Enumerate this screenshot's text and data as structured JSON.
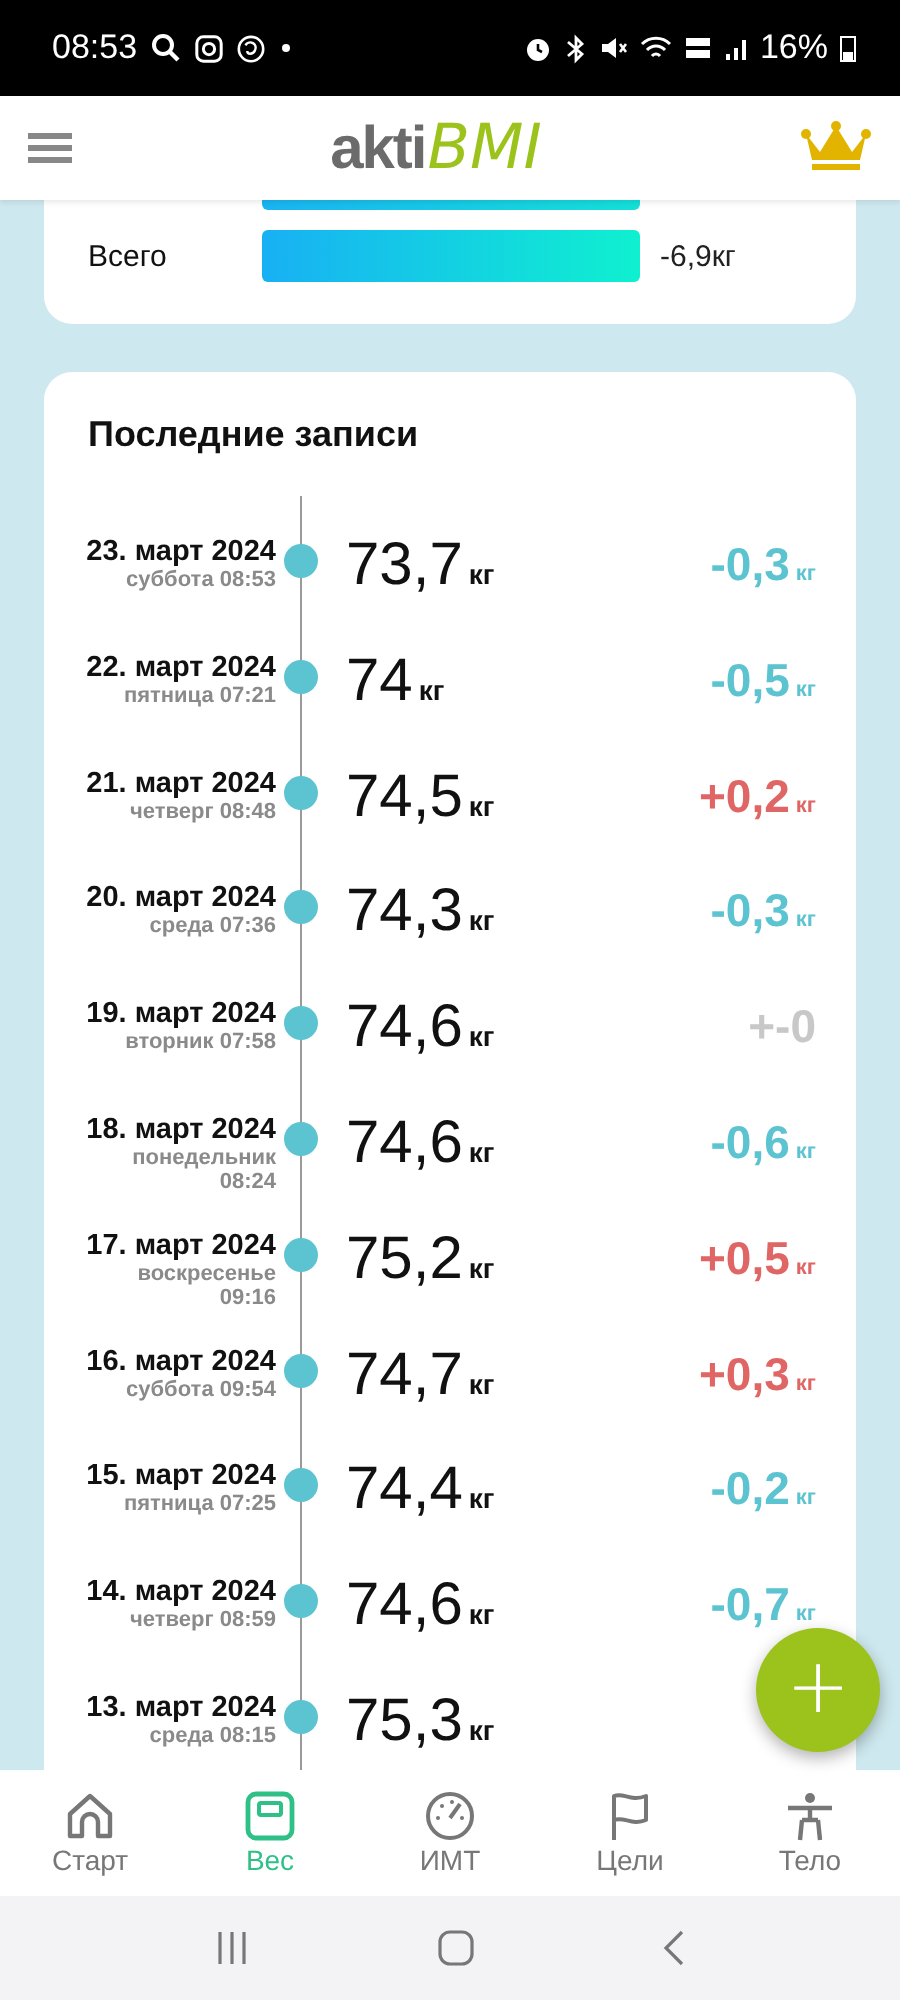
{
  "status_bar": {
    "time": "08:53",
    "battery": "16%"
  },
  "header": {
    "logo_main": "akti",
    "logo_accent": "BMI"
  },
  "summary": {
    "rows": [
      {
        "label": "Всего",
        "level": 1,
        "value": "-6,9кг"
      }
    ]
  },
  "entries_card": {
    "title": "Последние записи",
    "entries": [
      {
        "date": "23. март 2024",
        "time": "суббота 08:53",
        "weight": "73,7",
        "unit": "кг",
        "delta": "-0,3",
        "delta_unit": "кг",
        "kind": "down"
      },
      {
        "date": "22. март 2024",
        "time": "пятница 07:21",
        "weight": "74",
        "unit": "кг",
        "delta": "-0,5",
        "delta_unit": "кг",
        "kind": "down"
      },
      {
        "date": "21. март 2024",
        "time": "четверг 08:48",
        "weight": "74,5",
        "unit": "кг",
        "delta": "+0,2",
        "delta_unit": "кг",
        "kind": "up"
      },
      {
        "date": "20. март 2024",
        "time": "среда 07:36",
        "weight": "74,3",
        "unit": "кг",
        "delta": "-0,3",
        "delta_unit": "кг",
        "kind": "down"
      },
      {
        "date": "19. март 2024",
        "time": "вторник 07:58",
        "weight": "74,6",
        "unit": "кг",
        "delta": "+-0",
        "kind": "zero"
      },
      {
        "date": "18. март 2024",
        "time": "понедельник 08:24",
        "weight": "74,6",
        "unit": "кг",
        "delta": "-0,6",
        "delta_unit": "кг",
        "kind": "down"
      },
      {
        "date": "17. март 2024",
        "time": "воскресенье 09:16",
        "weight": "75,2",
        "unit": "кг",
        "delta": "+0,5",
        "delta_unit": "кг",
        "kind": "up"
      },
      {
        "date": "16. март 2024",
        "time": "суббота 09:54",
        "weight": "74,7",
        "unit": "кг",
        "delta": "+0,3",
        "delta_unit": "кг",
        "kind": "up"
      },
      {
        "date": "15. март 2024",
        "time": "пятница 07:25",
        "weight": "74,4",
        "unit": "кг",
        "delta": "-0,2",
        "delta_unit": "кг",
        "kind": "down"
      },
      {
        "date": "14. март 2024",
        "time": "четверг 08:59",
        "weight": "74,6",
        "unit": "кг",
        "delta": "-0,7",
        "delta_unit": "кг",
        "kind": "down"
      },
      {
        "date": "13. март 2024",
        "time": "среда 08:15",
        "weight": "75,3",
        "unit": "кг"
      }
    ]
  },
  "fab": {
    "label": "+"
  },
  "bottom_nav": [
    {
      "label": "Старт",
      "kind": "home",
      "selected": false
    },
    {
      "label": "Вес",
      "kind": "scale",
      "selected": true
    },
    {
      "label": "ИМТ",
      "kind": "gauge",
      "selected": false
    },
    {
      "label": "Цели",
      "kind": "flag",
      "selected": false
    },
    {
      "label": "Тело",
      "kind": "body",
      "selected": false
    }
  ]
}
